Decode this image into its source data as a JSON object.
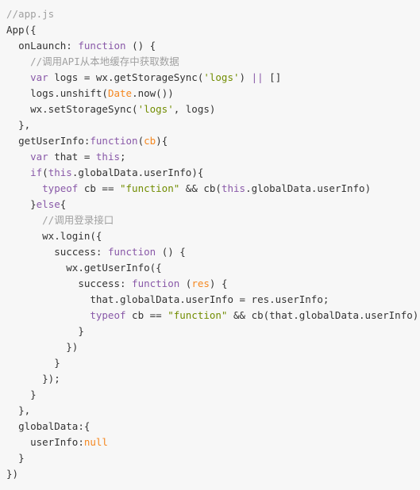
{
  "document": {
    "kind": "code-listing",
    "language": "javascript",
    "file_label": "//app.js",
    "background_color": "#f7f7f7",
    "colors": {
      "plain": "#333333",
      "comment": "#a0a0a0",
      "keyword": "#8959a8",
      "string": "#718c00",
      "builtin": "#f5871f",
      "param": "#f5871f"
    },
    "lines": [
      {
        "indent": 0,
        "tokens": [
          {
            "t": "//app.js",
            "c": "comment"
          }
        ]
      },
      {
        "indent": 0,
        "tokens": [
          {
            "t": "App({",
            "c": "plain"
          }
        ]
      },
      {
        "indent": 1,
        "tokens": [
          {
            "t": "onLaunch: ",
            "c": "plain"
          },
          {
            "t": "function",
            "c": "keyword"
          },
          {
            "t": " () {",
            "c": "plain"
          }
        ]
      },
      {
        "indent": 2,
        "tokens": [
          {
            "t": "//调用API从本地缓存中获取数据",
            "c": "comment"
          }
        ]
      },
      {
        "indent": 2,
        "tokens": [
          {
            "t": "var",
            "c": "keyword"
          },
          {
            "t": " logs = wx.getStorageSync(",
            "c": "plain"
          },
          {
            "t": "'logs'",
            "c": "string"
          },
          {
            "t": ") ",
            "c": "plain"
          },
          {
            "t": "||",
            "c": "keyword"
          },
          {
            "t": " []",
            "c": "plain"
          }
        ]
      },
      {
        "indent": 2,
        "tokens": [
          {
            "t": "logs.unshift(",
            "c": "plain"
          },
          {
            "t": "Date",
            "c": "builtin"
          },
          {
            "t": ".now())",
            "c": "plain"
          }
        ]
      },
      {
        "indent": 2,
        "tokens": [
          {
            "t": "wx.setStorageSync(",
            "c": "plain"
          },
          {
            "t": "'logs'",
            "c": "string"
          },
          {
            "t": ", logs)",
            "c": "plain"
          }
        ]
      },
      {
        "indent": 1,
        "tokens": [
          {
            "t": "},",
            "c": "plain"
          }
        ]
      },
      {
        "indent": 1,
        "tokens": [
          {
            "t": "getUserInfo:",
            "c": "plain"
          },
          {
            "t": "function",
            "c": "keyword"
          },
          {
            "t": "(",
            "c": "plain"
          },
          {
            "t": "cb",
            "c": "param"
          },
          {
            "t": "){",
            "c": "plain"
          }
        ]
      },
      {
        "indent": 2,
        "tokens": [
          {
            "t": "var",
            "c": "keyword"
          },
          {
            "t": " that = ",
            "c": "plain"
          },
          {
            "t": "this",
            "c": "keyword"
          },
          {
            "t": ";",
            "c": "plain"
          }
        ]
      },
      {
        "indent": 2,
        "tokens": [
          {
            "t": "if",
            "c": "keyword"
          },
          {
            "t": "(",
            "c": "plain"
          },
          {
            "t": "this",
            "c": "keyword"
          },
          {
            "t": ".globalData.userInfo){",
            "c": "plain"
          }
        ]
      },
      {
        "indent": 3,
        "tokens": [
          {
            "t": "typeof",
            "c": "keyword"
          },
          {
            "t": " cb == ",
            "c": "plain"
          },
          {
            "t": "\"function\"",
            "c": "string"
          },
          {
            "t": " && cb(",
            "c": "plain"
          },
          {
            "t": "this",
            "c": "keyword"
          },
          {
            "t": ".globalData.userInfo)",
            "c": "plain"
          }
        ]
      },
      {
        "indent": 2,
        "tokens": [
          {
            "t": "}",
            "c": "plain"
          },
          {
            "t": "else",
            "c": "keyword"
          },
          {
            "t": "{",
            "c": "plain"
          }
        ]
      },
      {
        "indent": 3,
        "tokens": [
          {
            "t": "//调用登录接口",
            "c": "comment"
          }
        ]
      },
      {
        "indent": 3,
        "tokens": [
          {
            "t": "wx.login({",
            "c": "plain"
          }
        ]
      },
      {
        "indent": 4,
        "tokens": [
          {
            "t": "success: ",
            "c": "plain"
          },
          {
            "t": "function",
            "c": "keyword"
          },
          {
            "t": " () {",
            "c": "plain"
          }
        ]
      },
      {
        "indent": 5,
        "tokens": [
          {
            "t": "wx.getUserInfo({",
            "c": "plain"
          }
        ]
      },
      {
        "indent": 6,
        "tokens": [
          {
            "t": "success: ",
            "c": "plain"
          },
          {
            "t": "function",
            "c": "keyword"
          },
          {
            "t": " (",
            "c": "plain"
          },
          {
            "t": "res",
            "c": "param"
          },
          {
            "t": ") {",
            "c": "plain"
          }
        ]
      },
      {
        "indent": 7,
        "tokens": [
          {
            "t": "that.globalData.userInfo = res.userInfo;",
            "c": "plain"
          }
        ]
      },
      {
        "indent": 7,
        "tokens": [
          {
            "t": "typeof",
            "c": "keyword"
          },
          {
            "t": " cb == ",
            "c": "plain"
          },
          {
            "t": "\"function\"",
            "c": "string"
          },
          {
            "t": " && cb(that.globalData.userInfo)",
            "c": "plain"
          }
        ]
      },
      {
        "indent": 6,
        "tokens": [
          {
            "t": "}",
            "c": "plain"
          }
        ]
      },
      {
        "indent": 5,
        "tokens": [
          {
            "t": "})",
            "c": "plain"
          }
        ]
      },
      {
        "indent": 4,
        "tokens": [
          {
            "t": "}",
            "c": "plain"
          }
        ]
      },
      {
        "indent": 3,
        "tokens": [
          {
            "t": "});",
            "c": "plain"
          }
        ]
      },
      {
        "indent": 2,
        "tokens": [
          {
            "t": "}",
            "c": "plain"
          }
        ]
      },
      {
        "indent": 1,
        "tokens": [
          {
            "t": "},",
            "c": "plain"
          }
        ]
      },
      {
        "indent": 1,
        "tokens": [
          {
            "t": "globalData:{",
            "c": "plain"
          }
        ]
      },
      {
        "indent": 2,
        "tokens": [
          {
            "t": "userInfo:",
            "c": "plain"
          },
          {
            "t": "null",
            "c": "builtin"
          }
        ]
      },
      {
        "indent": 1,
        "tokens": [
          {
            "t": "}",
            "c": "plain"
          }
        ]
      },
      {
        "indent": 0,
        "tokens": [
          {
            "t": "})",
            "c": "plain"
          }
        ]
      }
    ]
  }
}
